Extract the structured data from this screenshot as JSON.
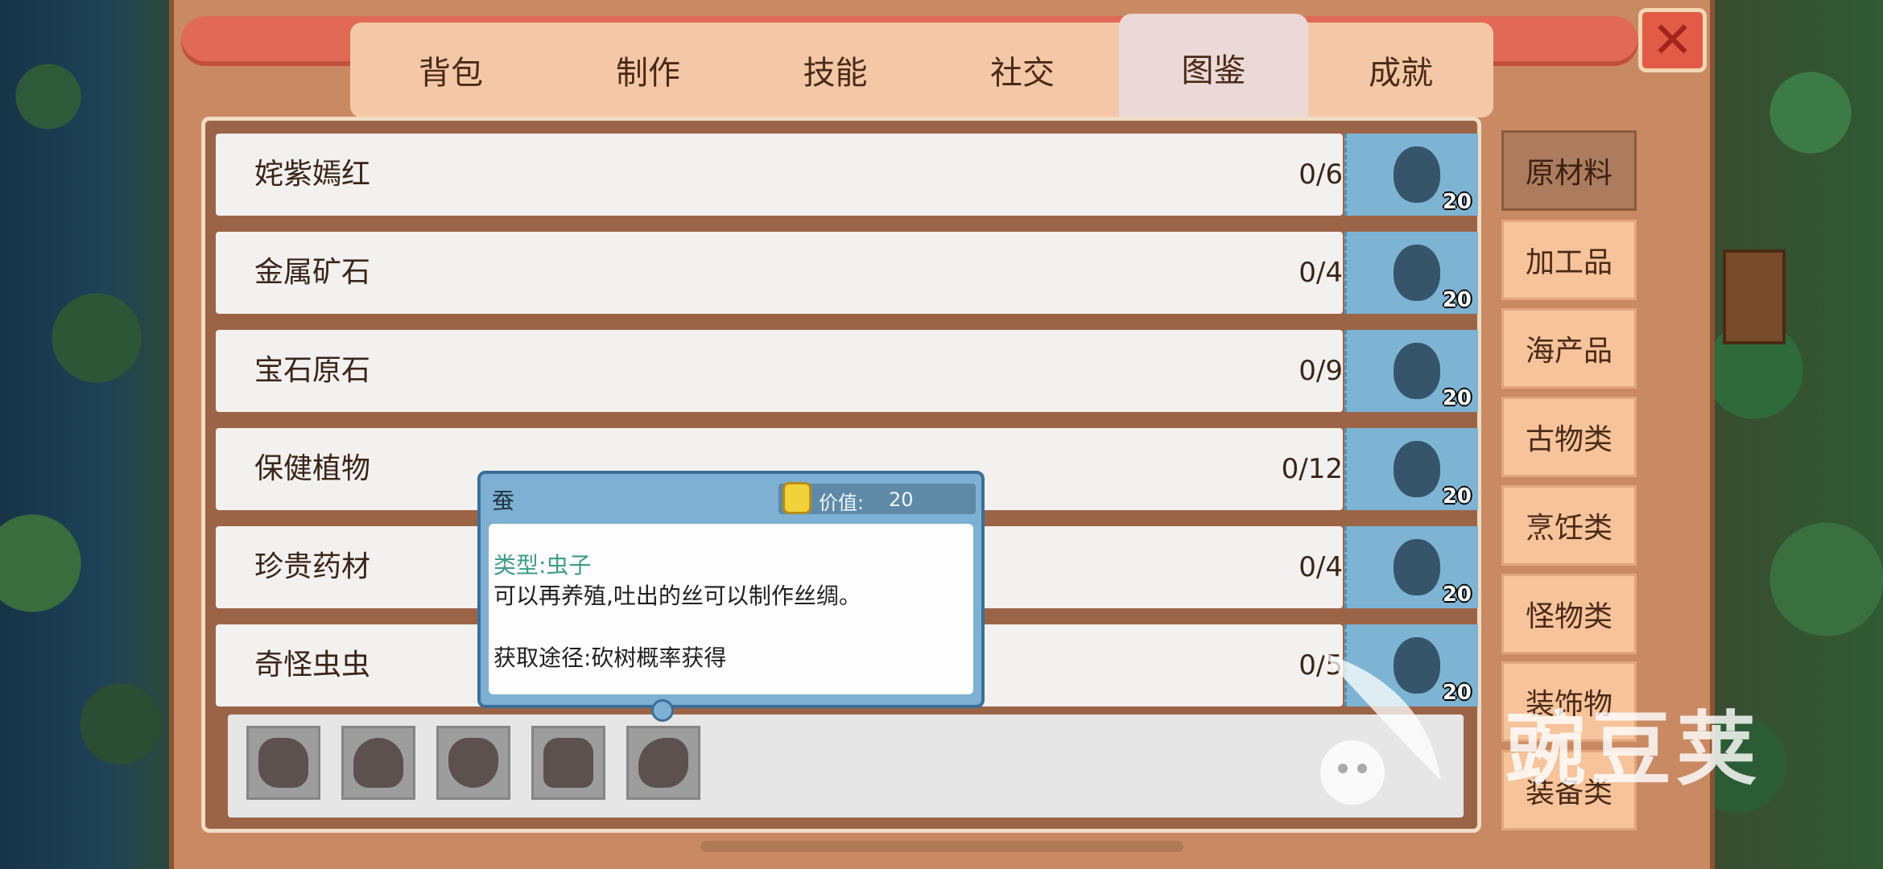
{
  "tabs": [
    {
      "label": "背包"
    },
    {
      "label": "制作"
    },
    {
      "label": "技能"
    },
    {
      "label": "社交"
    },
    {
      "label": "图鉴",
      "active": true
    },
    {
      "label": "成就"
    }
  ],
  "close": {
    "icon": "close-icon",
    "label": "✕"
  },
  "rows": [
    {
      "name": "姹紫嫣红",
      "count": "0/6",
      "icon_num": "20"
    },
    {
      "name": "金属矿石",
      "count": "0/4",
      "icon_num": "20"
    },
    {
      "name": "宝石原石",
      "count": "0/9",
      "icon_num": "20"
    },
    {
      "name": "保健植物",
      "count": "0/12",
      "icon_num": "20"
    },
    {
      "name": "珍贵药材",
      "count": "0/4",
      "icon_num": "20"
    },
    {
      "name": "奇怪虫虫",
      "count": "0/5",
      "icon_num": "20"
    }
  ],
  "categories": [
    {
      "label": "原材料",
      "active": true
    },
    {
      "label": "加工品"
    },
    {
      "label": "海产品"
    },
    {
      "label": "古物类"
    },
    {
      "label": "烹饪类"
    },
    {
      "label": "怪物类"
    },
    {
      "label": "装饰物"
    },
    {
      "label": "装备类"
    }
  ],
  "tooltip": {
    "title": "蚕",
    "value_label": "价值:",
    "value": "20",
    "type": "类型:虫子",
    "description": "可以再养殖,吐出的丝可以制作丝绸。",
    "source": "获取途径:砍树概率获得"
  },
  "bottom_slots": [
    "bug-silhouette-icon",
    "bug-silhouette-icon",
    "crab-silhouette-icon",
    "bug-silhouette-icon",
    "snail-silhouette-icon"
  ],
  "watermark": "豌豆荚",
  "colors": {
    "frame": "#c98a63",
    "tab_bar": "#f4c8a6",
    "active_tab": "#ead9d6",
    "category": "#f6c39b",
    "category_active": "#ad7b5e",
    "icon_box": "#7db4d4",
    "tooltip": "#7db0d2",
    "close": "#e15b47"
  }
}
